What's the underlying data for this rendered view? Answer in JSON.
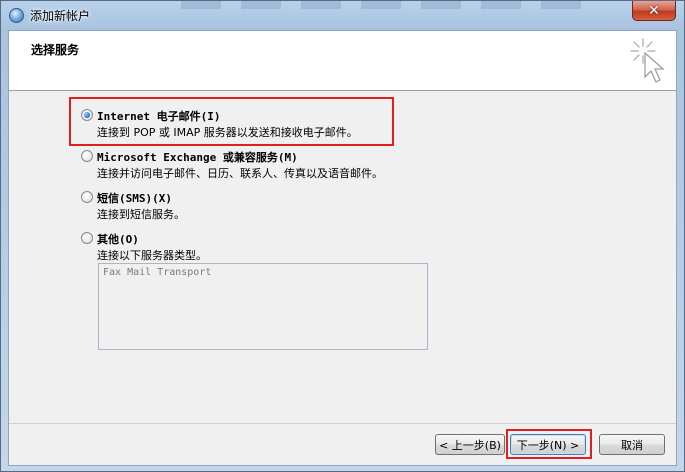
{
  "window": {
    "title": "添加新帐户",
    "close_symbol": "✕"
  },
  "header": {
    "heading": "选择服务",
    "icon": "wizard-cursor-icon"
  },
  "options": [
    {
      "label": "Internet 电子邮件(I)",
      "description": "连接到 POP 或 IMAP 服务器以发送和接收电子邮件。",
      "selected": true
    },
    {
      "label": "Microsoft Exchange 或兼容服务(M)",
      "description": "连接并访问电子邮件、日历、联系人、传真以及语音邮件。",
      "selected": false
    },
    {
      "label": "短信(SMS)(X)",
      "description": "连接到短信服务。",
      "selected": false
    },
    {
      "label": "其他(O)",
      "description": "连接以下服务器类型。",
      "selected": false
    }
  ],
  "other_server_types": [
    "Fax Mail Transport"
  ],
  "buttons": {
    "back": "< 上一步(B)",
    "next": "下一步(N) >",
    "cancel": "取消"
  },
  "colors": {
    "annotation_red": "#e02020",
    "accent_blue": "#2d7ad0"
  }
}
